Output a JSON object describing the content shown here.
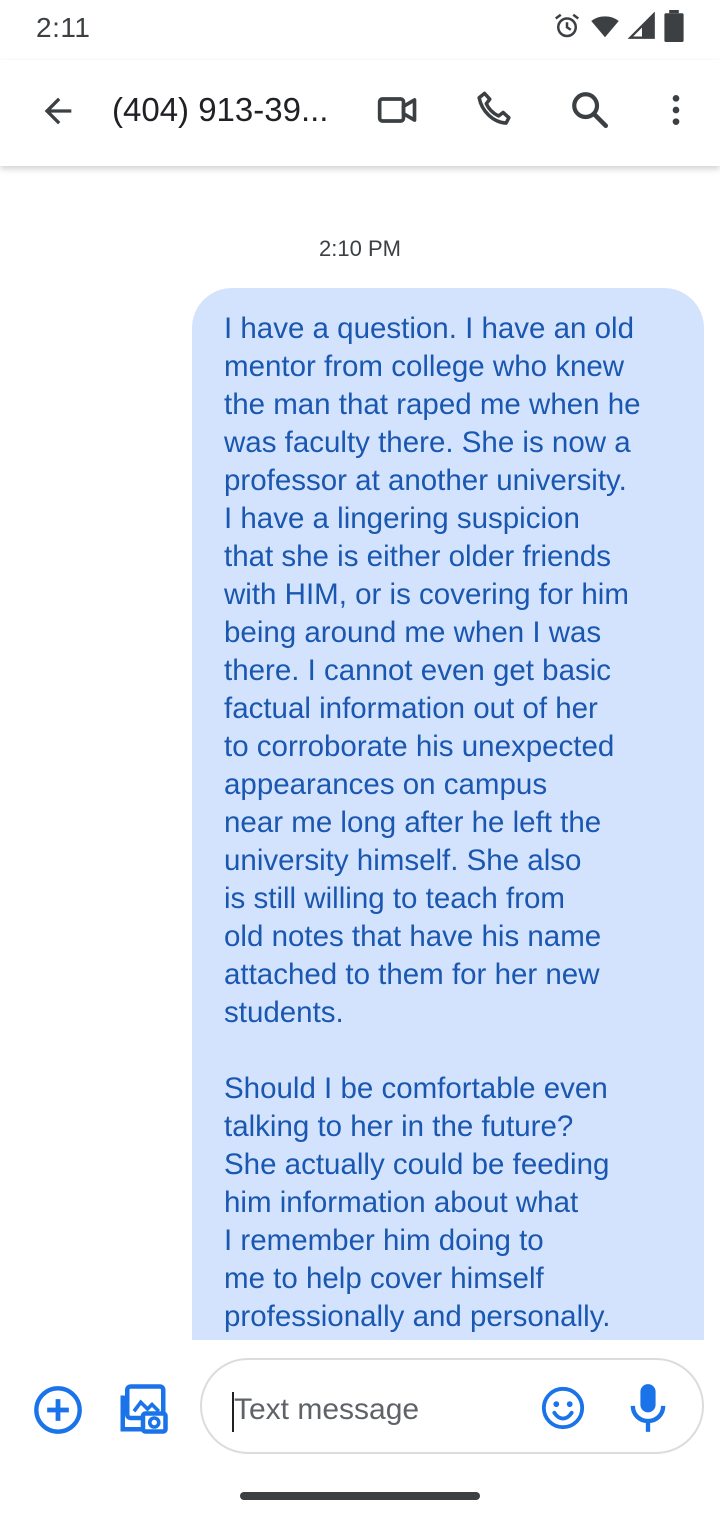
{
  "status_bar": {
    "time": "2:11",
    "icons": [
      "alarm-icon",
      "wifi-icon",
      "signal-icon",
      "battery-icon"
    ]
  },
  "header": {
    "title": "(404) 913-39...",
    "actions": [
      "back-arrow-icon",
      "video-call-icon",
      "phone-icon",
      "search-icon",
      "more-vert-icon"
    ]
  },
  "conversation": {
    "timestamp": "2:10 PM",
    "message": "I have a question. I have an old\nmentor from college who knew\nthe man that raped me when he\nwas faculty there. She is now a\nprofessor at another university.\nI have a lingering suspicion\nthat she is either older friends\nwith HIM, or is covering for him\nbeing around me when I was\nthere. I cannot even get basic\nfactual information out of her\nto corroborate his unexpected\nappearances on campus\nnear me long after he left the\nuniversity himself. She also\nis still willing to teach from\nold notes that have his name\nattached to them for her new\nstudents.\n\nShould I be comfortable even\ntalking to her in the future?\nShe actually could be feeding\nhim information about what\nI remember him doing to\nme to help cover himself\nprofessionally and personally."
  },
  "composer": {
    "placeholder": "Text message",
    "value": "",
    "icons": [
      "add-circle-icon",
      "gallery-icon",
      "emoji-icon",
      "mic-icon"
    ]
  },
  "colors": {
    "accent": "#1a73e8",
    "bubble_background": "#d3e3fd",
    "bubble_text": "#1a57b0"
  }
}
